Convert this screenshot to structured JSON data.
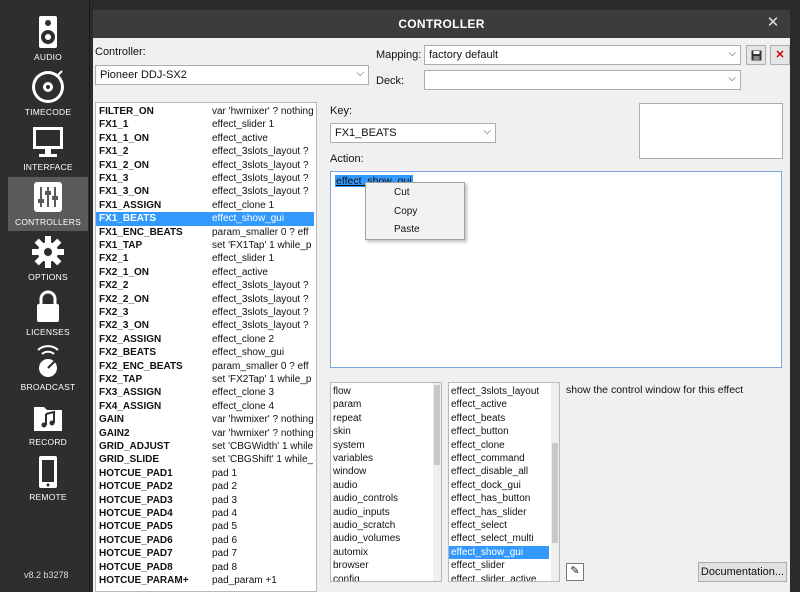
{
  "sidebar": {
    "items": [
      {
        "label": "AUDIO",
        "icon": "speaker-icon"
      },
      {
        "label": "TIMECODE",
        "icon": "vinyl-icon"
      },
      {
        "label": "INTERFACE",
        "icon": "monitor-icon"
      },
      {
        "label": "CONTROLLERS",
        "icon": "sliders-icon"
      },
      {
        "label": "OPTIONS",
        "icon": "gear-icon"
      },
      {
        "label": "LICENSES",
        "icon": "lock-icon"
      },
      {
        "label": "BROADCAST",
        "icon": "broadcast-icon"
      },
      {
        "label": "RECORD",
        "icon": "record-folder-icon"
      },
      {
        "label": "REMOTE",
        "icon": "tablet-icon"
      }
    ],
    "active_index": 3,
    "version": "v8.2 b3278"
  },
  "dialog": {
    "title": "CONTROLLER",
    "controller_label": "Controller:",
    "controller_value": "Pioneer DDJ-SX2",
    "mapping_label": "Mapping:",
    "mapping_value": "factory default",
    "deck_label": "Deck:",
    "deck_value": "",
    "key_label": "Key:",
    "key_value": "FX1_BEATS",
    "action_label": "Action:",
    "action_value": "effect_show_gui",
    "description": "show the control window for this effect",
    "documentation_label": "Documentation...",
    "context_menu": [
      "Cut",
      "Copy",
      "Paste"
    ]
  },
  "controls": [
    [
      "FILTER_ON",
      "var 'hwmixer' ? nothing"
    ],
    [
      "FX1_1",
      "effect_slider 1"
    ],
    [
      "FX1_1_ON",
      "effect_active"
    ],
    [
      "FX1_2",
      "effect_3slots_layout ?"
    ],
    [
      "FX1_2_ON",
      "effect_3slots_layout ?"
    ],
    [
      "FX1_3",
      "effect_3slots_layout ?"
    ],
    [
      "FX1_3_ON",
      "effect_3slots_layout ?"
    ],
    [
      "FX1_ASSIGN",
      "effect_clone 1"
    ],
    [
      "FX1_BEATS",
      "effect_show_gui"
    ],
    [
      "FX1_ENC_BEATS",
      "param_smaller 0 ? eff"
    ],
    [
      "FX1_TAP",
      "set 'FX1Tap' 1 while_p"
    ],
    [
      "FX2_1",
      "effect_slider 1"
    ],
    [
      "FX2_1_ON",
      "effect_active"
    ],
    [
      "FX2_2",
      "effect_3slots_layout ?"
    ],
    [
      "FX2_2_ON",
      "effect_3slots_layout ?"
    ],
    [
      "FX2_3",
      "effect_3slots_layout ?"
    ],
    [
      "FX2_3_ON",
      "effect_3slots_layout ?"
    ],
    [
      "FX2_ASSIGN",
      "effect_clone 2"
    ],
    [
      "FX2_BEATS",
      "effect_show_gui"
    ],
    [
      "FX2_ENC_BEATS",
      "param_smaller 0 ? eff"
    ],
    [
      "FX2_TAP",
      "set 'FX2Tap' 1 while_p"
    ],
    [
      "FX3_ASSIGN",
      "effect_clone 3"
    ],
    [
      "FX4_ASSIGN",
      "effect_clone 4"
    ],
    [
      "GAIN",
      "var 'hwmixer' ? nothing"
    ],
    [
      "GAIN2",
      "var 'hwmixer' ? nothing"
    ],
    [
      "GRID_ADJUST",
      "set 'CBGWidth' 1 while"
    ],
    [
      "GRID_SLIDE",
      "set 'CBGShift' 1 while_"
    ],
    [
      "HOTCUE_PAD1",
      "pad 1"
    ],
    [
      "HOTCUE_PAD2",
      "pad 2"
    ],
    [
      "HOTCUE_PAD3",
      "pad 3"
    ],
    [
      "HOTCUE_PAD4",
      "pad 4"
    ],
    [
      "HOTCUE_PAD5",
      "pad 5"
    ],
    [
      "HOTCUE_PAD6",
      "pad 6"
    ],
    [
      "HOTCUE_PAD7",
      "pad 7"
    ],
    [
      "HOTCUE_PAD8",
      "pad 8"
    ],
    [
      "HOTCUE_PARAM+",
      "pad_param +1"
    ]
  ],
  "selected_control_index": 8,
  "categories": [
    "flow",
    "param",
    "repeat",
    "skin",
    "system",
    "variables",
    "window",
    "audio",
    "audio_controls",
    "audio_inputs",
    "audio_scratch",
    "audio_volumes",
    "automix",
    "browser",
    "config"
  ],
  "verbs": [
    "effect_3slots_layout",
    "effect_active",
    "effect_beats",
    "effect_button",
    "effect_clone",
    "effect_command",
    "effect_disable_all",
    "effect_dock_gui",
    "effect_has_button",
    "effect_has_slider",
    "effect_select",
    "effect_select_multi",
    "effect_show_gui",
    "effect_slider",
    "effect_slider_active"
  ],
  "selected_verb_index": 12
}
